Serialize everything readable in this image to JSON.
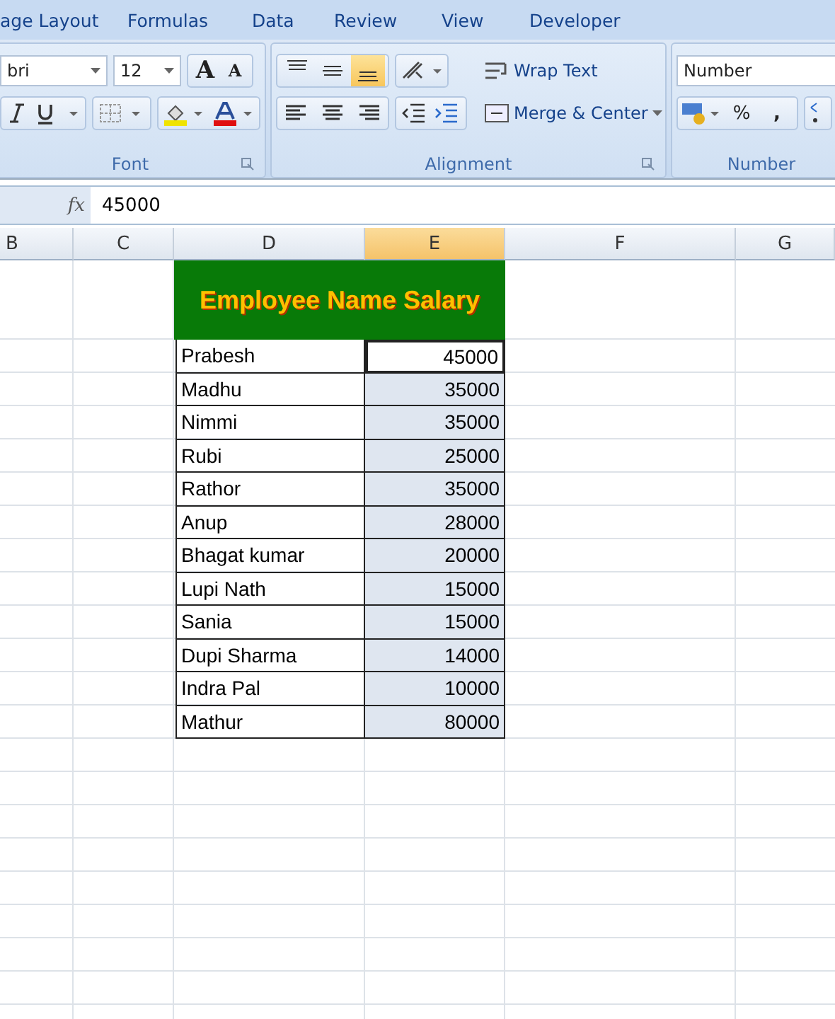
{
  "menu_tabs": [
    "age Layout",
    "Formulas",
    "Data",
    "Review",
    "View",
    "Developer"
  ],
  "ribbon": {
    "font": {
      "font_name": "bri",
      "font_size": "12",
      "grow_font": "A",
      "shrink_font": "A",
      "label": "Font"
    },
    "alignment": {
      "vertical": [
        {
          "kind": "top",
          "selected": false
        },
        {
          "kind": "middle",
          "selected": false
        },
        {
          "kind": "bottom",
          "selected": true
        }
      ],
      "wrap_text": "Wrap Text",
      "merge_center": "Merge & Center",
      "label": "Alignment"
    },
    "number": {
      "format": "Number",
      "percent": "%",
      "comma": ",",
      "label": "Number"
    }
  },
  "formula_bar": {
    "fx": "fx",
    "value": "45000"
  },
  "columns": [
    {
      "name": "B",
      "selected": false
    },
    {
      "name": "C",
      "selected": false
    },
    {
      "name": "D",
      "selected": false
    },
    {
      "name": "E",
      "selected": true
    },
    {
      "name": "F",
      "selected": false
    },
    {
      "name": "G",
      "selected": false
    }
  ],
  "table": {
    "title": "Employee Name Salary",
    "rows": [
      {
        "name": "Prabesh",
        "salary": "45000",
        "active": true
      },
      {
        "name": "Madhu",
        "salary": "35000",
        "active": false
      },
      {
        "name": "Nimmi",
        "salary": "35000",
        "active": false
      },
      {
        "name": "Rubi",
        "salary": "25000",
        "active": false
      },
      {
        "name": "Rathor",
        "salary": "35000",
        "active": false
      },
      {
        "name": "Anup",
        "salary": "28000",
        "active": false
      },
      {
        "name": "Bhagat kumar",
        "salary": "20000",
        "active": false
      },
      {
        "name": "Lupi Nath",
        "salary": "15000",
        "active": false
      },
      {
        "name": "Sania",
        "salary": "15000",
        "active": false
      },
      {
        "name": "Dupi Sharma",
        "salary": "14000",
        "active": false
      },
      {
        "name": "Indra Pal",
        "salary": "10000",
        "active": false
      },
      {
        "name": "Mathur",
        "salary": "80000",
        "active": false
      }
    ]
  }
}
